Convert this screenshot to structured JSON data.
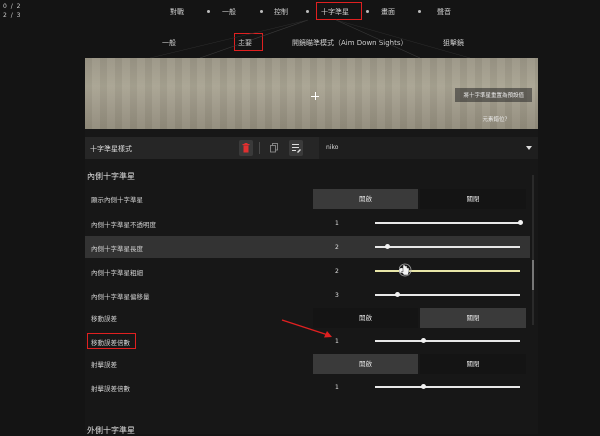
{
  "corner": {
    "line1": "0 / 2",
    "line2": "2 / 3"
  },
  "top_nav": [
    {
      "label": "對戰",
      "active": false
    },
    {
      "label": "一般",
      "active": false
    },
    {
      "label": "控制",
      "active": false
    },
    {
      "label": "十字準星",
      "active": true
    },
    {
      "label": "畫面",
      "active": false
    },
    {
      "label": "聲音",
      "active": false
    }
  ],
  "sub_nav": [
    {
      "label": "一般",
      "active": false
    },
    {
      "label": "主要",
      "active": true
    },
    {
      "label": "開鏡瞄準模式（Aim Down Sights）",
      "active": false
    },
    {
      "label": "狙擊鏡",
      "active": false
    }
  ],
  "preview": {
    "reset_button": "將十字準星重置為預設值",
    "locate_link": "元素錯位？"
  },
  "profile": {
    "label": "十字準星樣式",
    "selected": "niko"
  },
  "sections": {
    "inner": "內側十字準星",
    "outer": "外側十字準星"
  },
  "rows": [
    {
      "label": "顯示內側十字準星",
      "type": "toggle",
      "on_label": "開啟",
      "off_label": "關閉",
      "state": "on"
    },
    {
      "label": "內側十字準星不透明度",
      "type": "slider",
      "value": "1",
      "level": 1.0
    },
    {
      "label": "內側十字準星長度",
      "type": "slider",
      "value": "2",
      "level": 0.08
    },
    {
      "label": "內側十字準星粗細",
      "type": "slider",
      "value": "2",
      "level": 0.18
    },
    {
      "label": "內側十字準星偏移量",
      "type": "slider",
      "value": "3",
      "level": 0.15
    },
    {
      "label": "移動誤差",
      "type": "toggle",
      "on_label": "開啟",
      "off_label": "關閉",
      "state": "off"
    },
    {
      "label": "移動誤差倍數",
      "type": "slider",
      "value": "1",
      "level": 0.33
    },
    {
      "label": "射擊誤差",
      "type": "toggle",
      "on_label": "開啟",
      "off_label": "關閉",
      "state": "on"
    },
    {
      "label": "射擊誤差倍數",
      "type": "slider",
      "value": "1",
      "level": 0.33
    }
  ],
  "colors": {
    "highlight": "#e02020",
    "background": "#141414",
    "row_highlight": "#3a3a3a"
  }
}
